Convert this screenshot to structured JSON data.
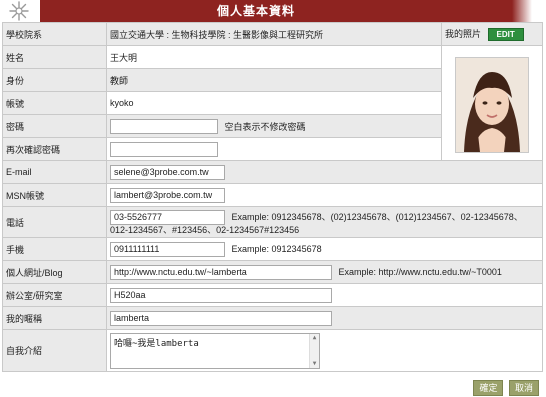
{
  "header": {
    "title": "個人基本資料",
    "logo_icon": "compass-star-icon"
  },
  "colors": {
    "header": "#8e2320",
    "edit": "#2e8f3e",
    "buttons": "#9aa16a",
    "label_bg": "#eaeaea"
  },
  "rows": {
    "school": {
      "label": "學校院系",
      "value": "國立交通大學 : 生物科技學院 : 生醫影像與工程研究所"
    },
    "photo": {
      "label": "我的照片",
      "edit": "EDIT"
    },
    "name": {
      "label": "姓名",
      "value": "王大明"
    },
    "identity": {
      "label": "身份",
      "value": "教師"
    },
    "account": {
      "label": "帳號",
      "value": "kyoko"
    },
    "password": {
      "label": "密碼",
      "value": "",
      "hint": "空白表示不修改密碼"
    },
    "password_confirm": {
      "label": "再次確認密碼",
      "value": ""
    },
    "email": {
      "label": "E-mail",
      "value": "selene@3probe.com.tw"
    },
    "msn": {
      "label": "MSN帳號",
      "value": "lambert@3probe.com.tw"
    },
    "phone": {
      "label": "電話",
      "value": "03-5526777",
      "hint1": "Example: 0912345678、(02)12345678、(012)1234567、02-12345678、",
      "hint2": "012-1234567、#123456、02-1234567#123456"
    },
    "mobile": {
      "label": "手機",
      "value": "0911111111",
      "hint": "Example: 0912345678"
    },
    "website": {
      "label": "個人網址/Blog",
      "value": "http://www.nctu.edu.tw/~lamberta",
      "hint": "Example: http://www.nctu.edu.tw/~T0001"
    },
    "office": {
      "label": "辦公室/研究室",
      "value": "H520aa"
    },
    "nickname": {
      "label": "我的暱稱",
      "value": "lamberta"
    },
    "intro": {
      "label": "自我介紹",
      "value": "哈囉~我是lamberta"
    }
  },
  "footer": {
    "confirm": "確定",
    "cancel": "取消"
  }
}
